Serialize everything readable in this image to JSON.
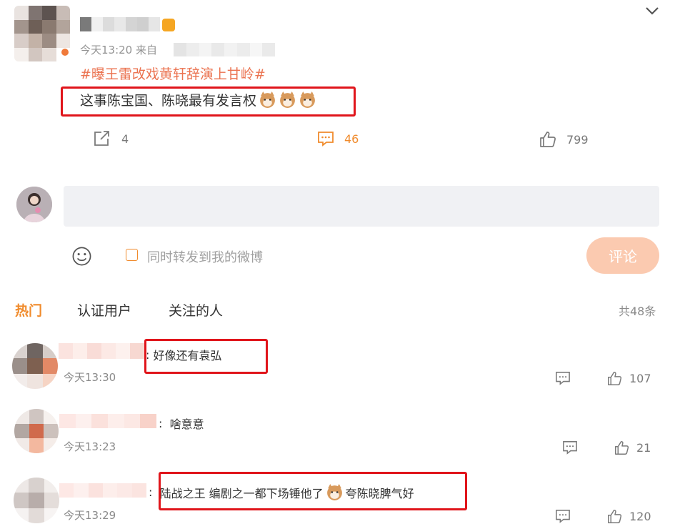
{
  "post": {
    "meta": "今天13:20  来自",
    "topic": "#曝王雷改戏黄轩辞演上甘岭#",
    "text": "这事陈宝国、陈晓最有发言权",
    "actions": {
      "repost_count": "4",
      "comment_count": "46",
      "like_count": "799"
    }
  },
  "composer": {
    "repost_label": "同时转发到我的微博",
    "submit_label": "评论"
  },
  "tabs": [
    {
      "label": "热门"
    },
    {
      "label": "认证用户"
    },
    {
      "label": "关注的人"
    }
  ],
  "total_label": "共48条",
  "comments": [
    {
      "text": "好像还有袁弘",
      "time": "今天13:30",
      "likes": "107"
    },
    {
      "text": "啥意意",
      "time": "今天13:23",
      "likes": "21"
    },
    {
      "text_before": "陆战之王 编剧之一都下场锤他了",
      "text_after": "夸陈晓脾气好",
      "time": "今天13:29",
      "likes": "120"
    }
  ],
  "colors": {
    "accent": "#f08b2c",
    "topic": "#eb7350",
    "highlight_box": "#e0151b",
    "submit_disabled": "#fbcab0"
  }
}
